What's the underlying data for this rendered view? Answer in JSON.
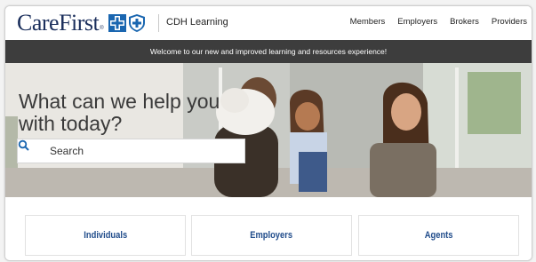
{
  "header": {
    "logo_text": "CareFirst",
    "logo_tm": "®",
    "product": "CDH Learning",
    "nav": [
      "Members",
      "Employers",
      "Brokers",
      "Providers"
    ]
  },
  "banner": {
    "text": "Welcome to our new and improved learning and resources experience!"
  },
  "hero": {
    "title": "What can we help you with today?",
    "search_placeholder": "Search"
  },
  "cards": [
    "Individuals",
    "Employers",
    "Agents"
  ],
  "colors": {
    "brand_navy": "#1b2f5c",
    "brand_blue": "#1a66b0",
    "banner_bg": "#3d3d3d",
    "card_text": "#1f4b8a"
  }
}
